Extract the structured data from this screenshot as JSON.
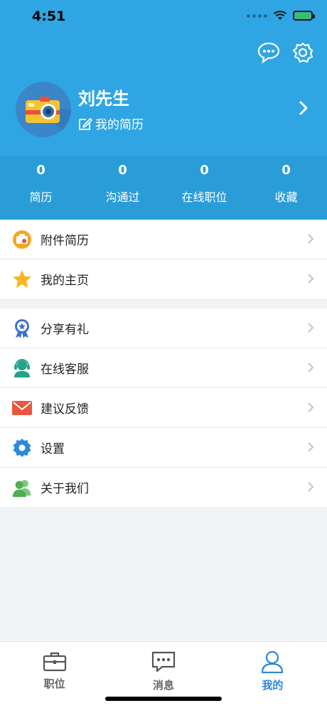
{
  "status_bar": {
    "time": "4:51"
  },
  "profile": {
    "name": "刘先生",
    "resume_link": "我的简历"
  },
  "stats": [
    {
      "value": "0",
      "label": "简历"
    },
    {
      "value": "0",
      "label": "沟通过"
    },
    {
      "value": "0",
      "label": "在线职位"
    },
    {
      "value": "0",
      "label": "收藏"
    }
  ],
  "menu_group1": [
    {
      "label": "附件简历",
      "icon": "attachment-resume-icon",
      "color": "#f6a623"
    },
    {
      "label": "我的主页",
      "icon": "star-icon",
      "color": "#f8b624"
    }
  ],
  "menu_group2": [
    {
      "label": "分享有礼",
      "icon": "award-icon",
      "color": "#3c73c9"
    },
    {
      "label": "在线客服",
      "icon": "support-agent-icon",
      "color": "#22a48d"
    },
    {
      "label": "建议反馈",
      "icon": "mail-icon",
      "color": "#e9573f"
    },
    {
      "label": "设置",
      "icon": "gear-icon",
      "color": "#2b8ad9"
    },
    {
      "label": "关于我们",
      "icon": "users-icon",
      "color": "#4caf50"
    }
  ],
  "tabbar": {
    "jobs": "职位",
    "messages": "消息",
    "mine": "我的"
  },
  "colors": {
    "header": "#2fa6e3",
    "accent": "#2a86dc"
  }
}
